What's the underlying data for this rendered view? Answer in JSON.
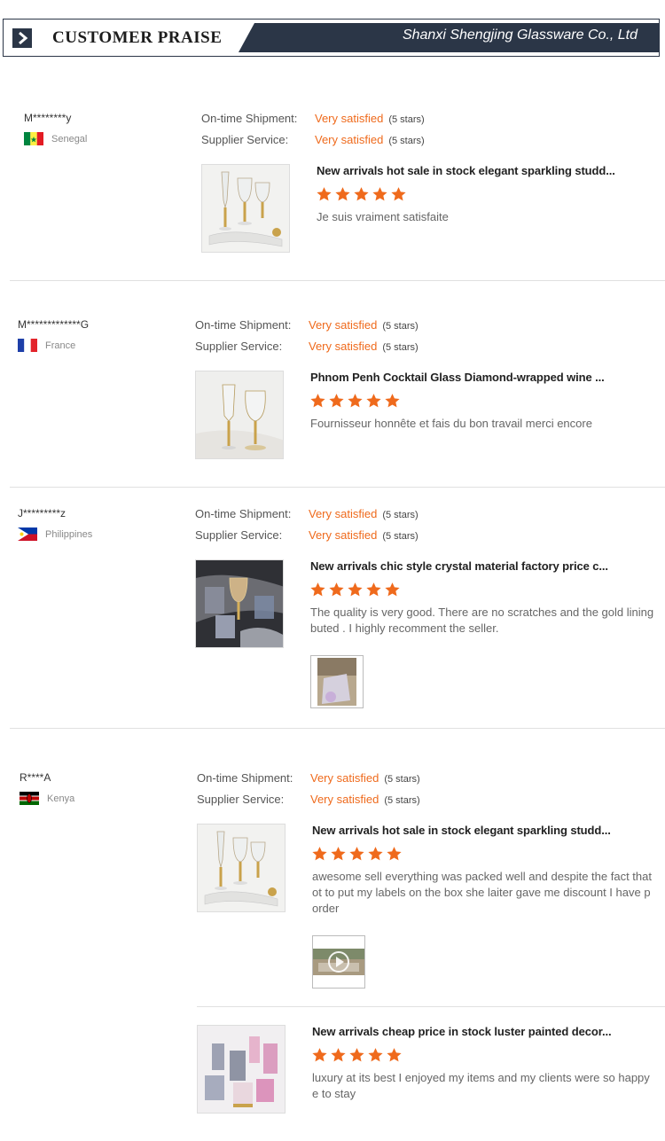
{
  "header": {
    "title": "CUSTOMER PRAISE",
    "company": "Shanxi Shengjing Glassware Co., Ltd",
    "accent": "#2b3647"
  },
  "labels": {
    "shipment": "On-time Shipment:",
    "service": "Supplier Service:",
    "satisfied": "Very satisfied",
    "stars_note": "(5 stars)"
  },
  "colors": {
    "accent": "#ef6a1c",
    "star": "#ef6a1c"
  },
  "reviews": [
    {
      "user": "M********y",
      "country": "Senegal",
      "flag": "senegal-flag",
      "items": [
        {
          "title": "New arrivals hot sale in stock elegant sparkling studd...",
          "rating": 5,
          "comment_lines": [
            "Je suis vraiment satisfaite"
          ]
        }
      ]
    },
    {
      "user": "M*************G",
      "country": "France",
      "flag": "france-flag",
      "items": [
        {
          "title": "Phnom Penh Cocktail Glass Diamond-wrapped wine ...",
          "rating": 5,
          "comment_lines": [
            "Fournisseur honnête et fais du bon travail merci encore"
          ]
        }
      ]
    },
    {
      "user": "J*********z",
      "country": "Philippines",
      "flag": "philippines-flag",
      "items": [
        {
          "title": "New arrivals chic style crystal material factory price c...",
          "rating": 5,
          "comment_lines": [
            "The quality is very good. There are no scratches and the gold lining",
            "buted . I highly recomment the seller."
          ]
        }
      ]
    },
    {
      "user": "R****A",
      "country": "Kenya",
      "flag": "kenya-flag",
      "items": [
        {
          "title": "New arrivals hot sale in stock elegant sparkling studd...",
          "rating": 5,
          "comment_lines": [
            "awesome sell everything was packed well and despite the fact that",
            "ot to put my labels on the box she laiter gave me discount I  have p",
            "order"
          ]
        },
        {
          "title": "New arrivals cheap price in stock luster painted decor...",
          "rating": 5,
          "comment_lines": [
            "luxury at its best I enjoyed my items and my clients were so happy",
            "e to stay"
          ]
        }
      ]
    }
  ]
}
